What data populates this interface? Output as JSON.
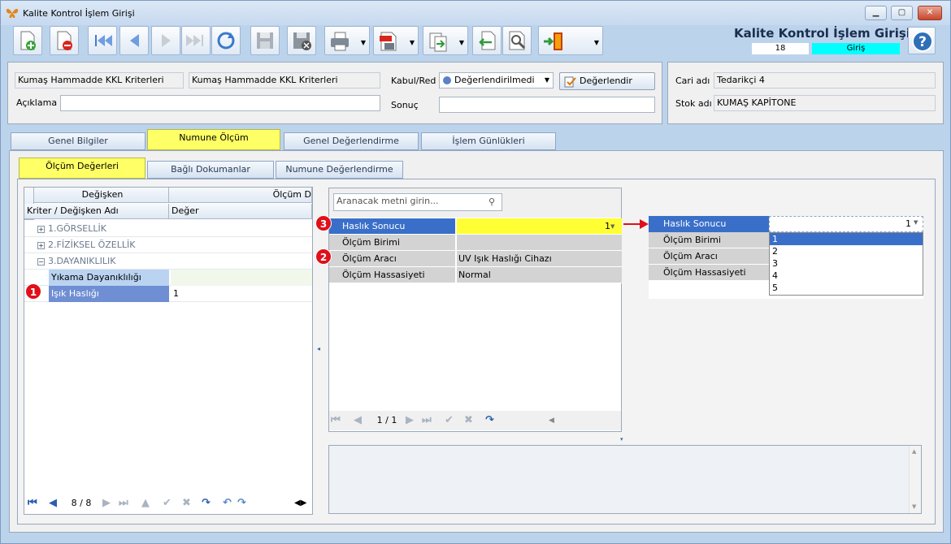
{
  "window": {
    "title": "Kalite Kontrol İşlem Girişi"
  },
  "header": {
    "app_title": "Kalite Kontrol İşlem Girişi",
    "record_no": "18",
    "mode": "Giriş"
  },
  "top_form": {
    "criteria_code": "Kumaş Hammadde KKL Kriterleri",
    "criteria_name": "Kumaş Hammadde KKL Kriterleri",
    "description_label": "Açıklama",
    "description_value": "",
    "accept_reject_label": "Kabul/Red",
    "accept_reject_value": "Değerlendirilmedi",
    "result_label": "Sonuç",
    "result_value": "",
    "evaluate_button": "Değerlendir",
    "account_label": "Cari adı",
    "account_value": "Tedarikçi 4",
    "stock_label": "Stok adı",
    "stock_value": "KUMAŞ KAPİTONE"
  },
  "main_tabs": [
    {
      "label": "Genel Bilgiler"
    },
    {
      "label": "Numune Ölçüm"
    },
    {
      "label": "Genel Değerlendirme"
    },
    {
      "label": "İşlem Günlükleri"
    }
  ],
  "sub_tabs": [
    {
      "label": "Ölçüm Değerleri"
    },
    {
      "label": "Bağlı Dokumanlar"
    },
    {
      "label": "Numune Değerlendirme"
    }
  ],
  "tree_grid": {
    "group_header_1": "Değişken",
    "group_header_2": "Ölçüm D",
    "col_1": "Kriter / Değişken Adı",
    "col_2": "Değer",
    "rows": [
      {
        "label": "1.GÖRSELLİK",
        "expander": "+"
      },
      {
        "label": "2.FİZİKSEL ÖZELLİK",
        "expander": "+"
      },
      {
        "label": "3.DAYANIKLILIK",
        "expander": "−"
      },
      {
        "label": "Yıkama Dayanıklılığı",
        "value": ""
      },
      {
        "label": "Işık Haslığı",
        "value": "1"
      }
    ],
    "nav_pos": "8 / 8"
  },
  "property_grid": {
    "search_placeholder": "Aranacak metni girin...",
    "rows": [
      {
        "key": "Haslık Sonucu",
        "value": "1"
      },
      {
        "key": "Ölçüm Birimi",
        "value": ""
      },
      {
        "key": "Ölçüm Aracı",
        "value": "UV Işık Haslığı Cihazı"
      },
      {
        "key": "Ölçüm Hassasiyeti",
        "value": "Normal"
      }
    ],
    "nav_pos": "1 / 1"
  },
  "callout": {
    "rows": [
      {
        "key": "Haslık Sonucu"
      },
      {
        "key": "Ölçüm Birimi"
      },
      {
        "key": "Ölçüm Aracı"
      },
      {
        "key": "Ölçüm Hassasiyeti"
      }
    ],
    "selected": "1",
    "options": [
      "1",
      "2",
      "3",
      "4",
      "5"
    ]
  },
  "markers": [
    "1",
    "2",
    "3"
  ],
  "colors": {
    "highlight": "#ffff66",
    "selection": "#3a6fc9",
    "mode_bg": "#00ffff",
    "marker": "#e0101b"
  }
}
